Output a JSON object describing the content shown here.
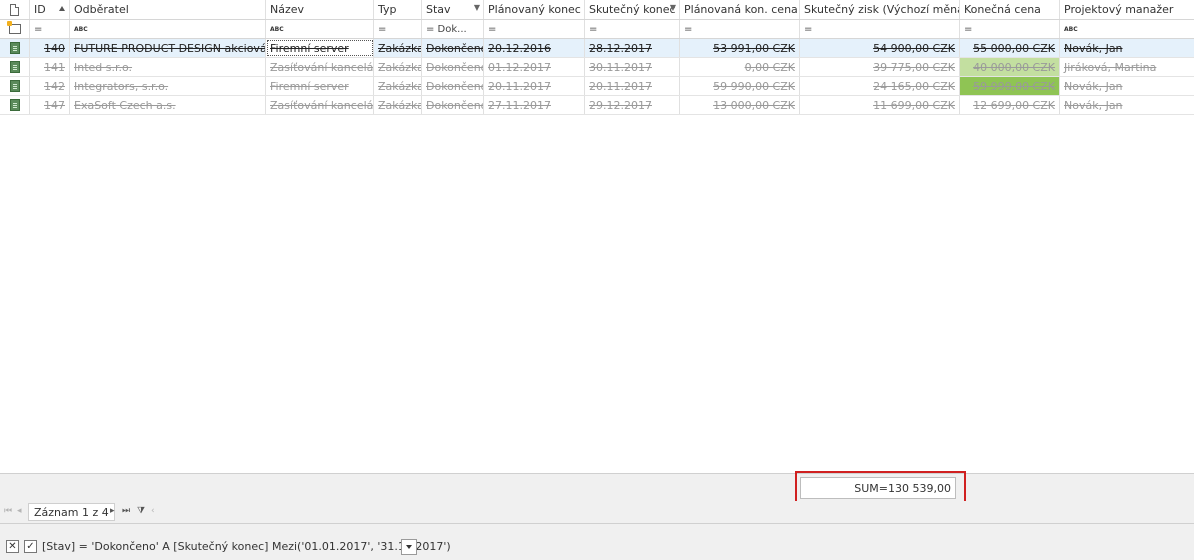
{
  "columns": [
    {
      "key": "id",
      "label": "ID",
      "sorted": "asc"
    },
    {
      "key": "odberatel",
      "label": "Odběratel"
    },
    {
      "key": "nazev",
      "label": "Název"
    },
    {
      "key": "typ",
      "label": "Typ"
    },
    {
      "key": "stav",
      "label": "Stav",
      "filtered": true
    },
    {
      "key": "planovany_konec",
      "label": "Plánovaný konec"
    },
    {
      "key": "skutecny_konec",
      "label": "Skutečný konec",
      "filtered": true
    },
    {
      "key": "planovana_cena",
      "label": "Plánovaná kon. cena"
    },
    {
      "key": "skutecny_zisk",
      "label": "Skutečný zisk (Výchozí měna)"
    },
    {
      "key": "konecna_cena",
      "label": "Konečná cena"
    },
    {
      "key": "manazer",
      "label": "Projektový manažer"
    }
  ],
  "filter_row": {
    "id": "=",
    "odberatel": "ABC",
    "nazev": "ABC",
    "typ": "=",
    "stav": "= Dok...",
    "planovany_konec": "=",
    "skutecny_konec": "=",
    "planovana_cena": "=",
    "skutecny_zisk": "=",
    "konecna_cena": "=",
    "manazer": "ABC"
  },
  "rows": [
    {
      "id": "140",
      "odberatel": "FUTURE PRODUCT DESIGN akciová ...",
      "nazev": "Firemní server",
      "typ": "Zakázka",
      "stav": "Dokončeno",
      "planovany_konec": "20.12.2016",
      "skutecny_konec": "28.12.2017",
      "planovana_cena": "53 991,00 CZK",
      "skutecny_zisk": "54 900,00 CZK",
      "konecna_cena": "55 000,00 CZK",
      "manazer": "Novák, Jan",
      "selected": true,
      "konecna_highlight": ""
    },
    {
      "id": "141",
      "odberatel": "Inted s.r.o.",
      "nazev": "Zasíťování kanceláře",
      "typ": "Zakázka",
      "stav": "Dokončeno",
      "planovany_konec": "01.12.2017",
      "skutecny_konec": "30.11.2017",
      "planovana_cena": "0,00 CZK",
      "skutecny_zisk": "39 775,00 CZK",
      "konecna_cena": "40 000,00 CZK",
      "manazer": "Jiráková, Martina",
      "selected": false,
      "konecna_highlight": "#c3dfa0"
    },
    {
      "id": "142",
      "odberatel": "Integrators, s.r.o.",
      "nazev": "Firemní server",
      "typ": "Zakázka",
      "stav": "Dokončeno",
      "planovany_konec": "20.11.2017",
      "skutecny_konec": "20.11.2017",
      "planovana_cena": "59 990,00 CZK",
      "skutecny_zisk": "24 165,00 CZK",
      "konecna_cena": "59 990,00 CZK",
      "manazer": "Novák, Jan",
      "selected": false,
      "konecna_highlight": "#8fc454"
    },
    {
      "id": "147",
      "odberatel": "ExaSoft Czech a.s.",
      "nazev": "Zasíťování kanceláře",
      "typ": "Zakázka",
      "stav": "Dokončeno",
      "planovany_konec": "27.11.2017",
      "skutecny_konec": "29.12.2017",
      "planovana_cena": "13 000,00 CZK",
      "skutecny_zisk": "11 699,00 CZK",
      "konecna_cena": "12 699,00 CZK",
      "manazer": "Novák, Jan",
      "selected": false,
      "konecna_highlight": ""
    }
  ],
  "summary": {
    "sum_label": "SUM=130 539,00"
  },
  "navigator": {
    "record_text": "Záznam 1 z 4"
  },
  "filter_panel": {
    "close_glyph": "✕",
    "check_glyph": "✓",
    "expression": "[Stav] = 'Dokončeno' A [Skutečný konec] Mezi('01.01.2017', '31.12.2017')"
  },
  "colors": {
    "selected_row": "#e5f1fb",
    "highlight_red": "#d02020",
    "strong_green": "#8fc454",
    "light_green": "#c3dfa0"
  }
}
